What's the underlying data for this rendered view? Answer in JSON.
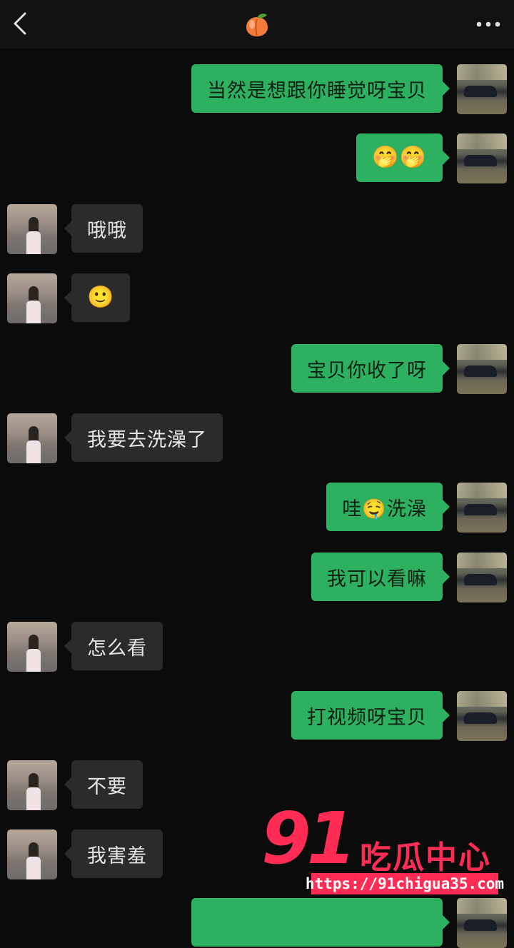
{
  "header": {
    "back_icon": "chevron-left-icon",
    "title_icon": "peach-emoji-icon",
    "title_glyph": "🍑",
    "more_icon": "more-horizontal-icon"
  },
  "colors": {
    "background": "#0b0b0b",
    "sent_bubble": "#2db160",
    "received_bubble": "#2b2b2b",
    "watermark": "#ff2d55"
  },
  "messages": [
    {
      "from": "me",
      "text": "当然是想跟你睡觉呀宝贝"
    },
    {
      "from": "me",
      "text": "🤭🤭"
    },
    {
      "from": "her",
      "text": "哦哦"
    },
    {
      "from": "her",
      "text": "🙂"
    },
    {
      "from": "me",
      "text": "宝贝你收了呀"
    },
    {
      "from": "her",
      "text": "我要去洗澡了"
    },
    {
      "from": "me",
      "text": "哇🤤洗澡"
    },
    {
      "from": "me",
      "text": "我可以看嘛"
    },
    {
      "from": "her",
      "text": "怎么看"
    },
    {
      "from": "me",
      "text": "打视频呀宝贝"
    },
    {
      "from": "her",
      "text": "不要"
    },
    {
      "from": "her",
      "text": "我害羞"
    },
    {
      "from": "me",
      "text": ""
    }
  ],
  "watermark": {
    "number": "91",
    "name": "吃瓜中心",
    "url": "https://91chigua35.com"
  }
}
